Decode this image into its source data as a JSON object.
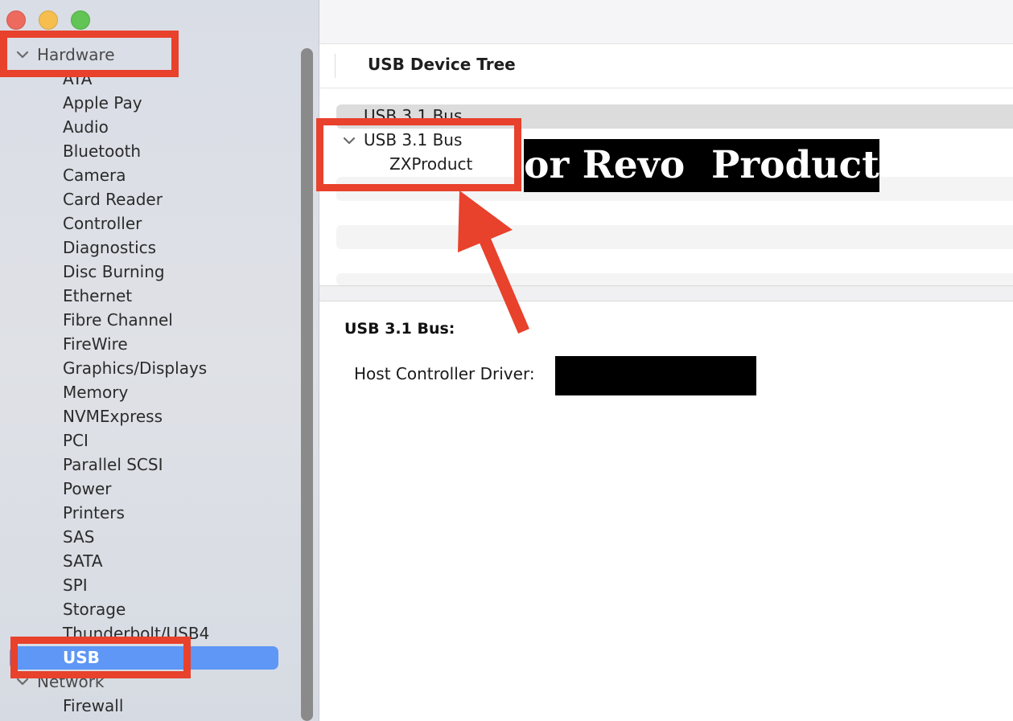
{
  "sidebar": {
    "hardware_section": "Hardware",
    "items": [
      "ATA",
      "Apple Pay",
      "Audio",
      "Bluetooth",
      "Camera",
      "Card Reader",
      "Controller",
      "Diagnostics",
      "Disc Burning",
      "Ethernet",
      "Fibre Channel",
      "FireWire",
      "Graphics/Displays",
      "Memory",
      "NVMExpress",
      "PCI",
      "Parallel SCSI",
      "Power",
      "Printers",
      "SAS",
      "SATA",
      "SPI",
      "Storage",
      "Thunderbolt/USB4"
    ],
    "selected_item": "USB",
    "network_section": "Network",
    "network_items": [
      "Firewall"
    ]
  },
  "tree": {
    "header": "USB Device Tree",
    "rows": [
      {
        "label": "USB 3.1 Bus"
      },
      {
        "label": "USB 3.1 Bus"
      },
      {
        "label": "ZXProduct"
      }
    ]
  },
  "detail": {
    "title": "USB 3.1 Bus:",
    "host_controller_label": "Host Controller Driver:"
  },
  "annotation": {
    "caption": "or Revo  Product",
    "highlight_color": "#e8412c"
  }
}
